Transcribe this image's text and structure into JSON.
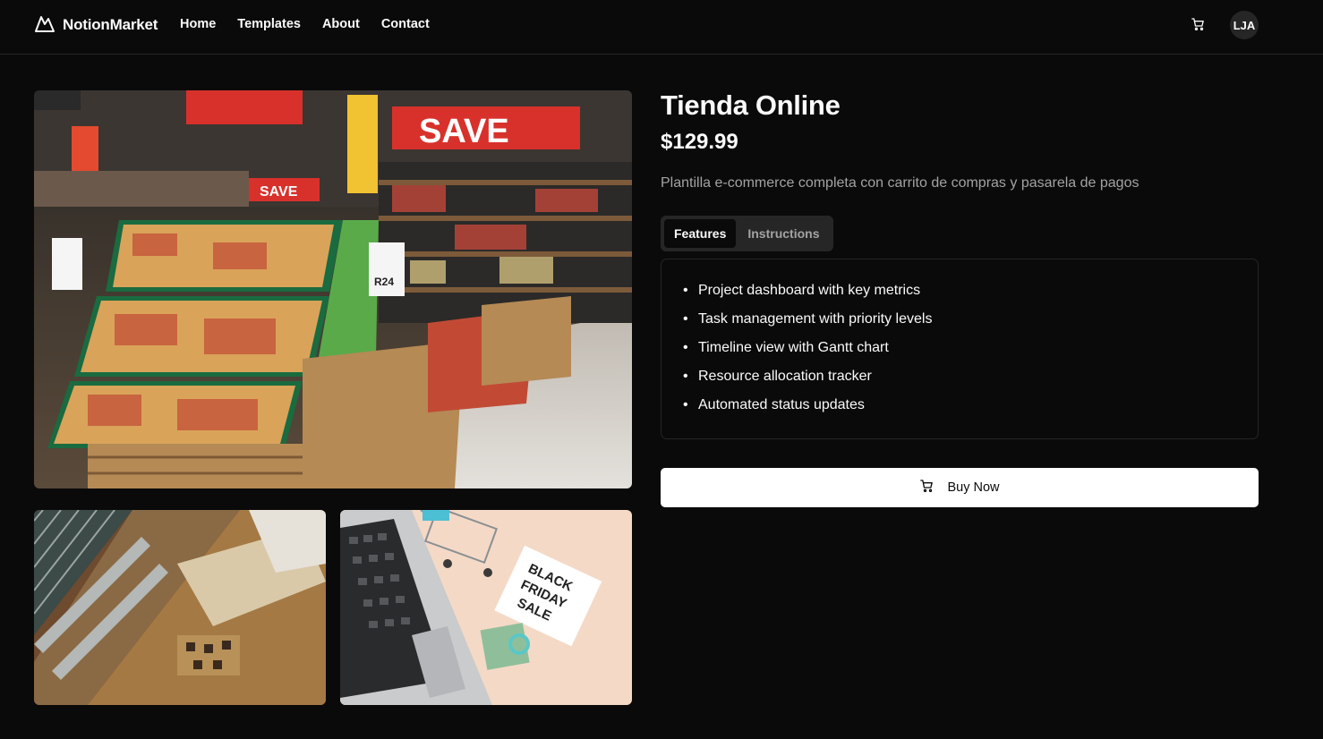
{
  "brand": {
    "name": "NotionMarket",
    "logo_icon": "mountain-logo-icon"
  },
  "nav": {
    "items": [
      {
        "label": "Home"
      },
      {
        "label": "Templates"
      },
      {
        "label": "About"
      },
      {
        "label": "Contact"
      }
    ]
  },
  "header": {
    "cart_icon": "cart-icon",
    "avatar_initials": "LJA"
  },
  "gallery": {
    "main_image": "supermarket-produce-aisle",
    "thumbnails": [
      "mall-escalators-aerial",
      "laptop-cart-black-friday-sale"
    ]
  },
  "product": {
    "title": "Tienda Online",
    "price": "$129.99",
    "description": "Plantilla e-commerce completa con carrito de compras y pasarela de pagos"
  },
  "tabs": [
    {
      "label": "Features",
      "active": true
    },
    {
      "label": "Instructions",
      "active": false
    }
  ],
  "features": [
    "Project dashboard with key metrics",
    "Task management with priority levels",
    "Timeline view with Gantt chart",
    "Resource allocation tracker",
    "Automated status updates"
  ],
  "buy": {
    "label": "Buy Now",
    "icon": "cart-icon"
  },
  "colors": {
    "background": "#0a0a0a",
    "border": "#262626",
    "muted_text": "#a3a3a3",
    "button_bg": "#ffffff"
  }
}
